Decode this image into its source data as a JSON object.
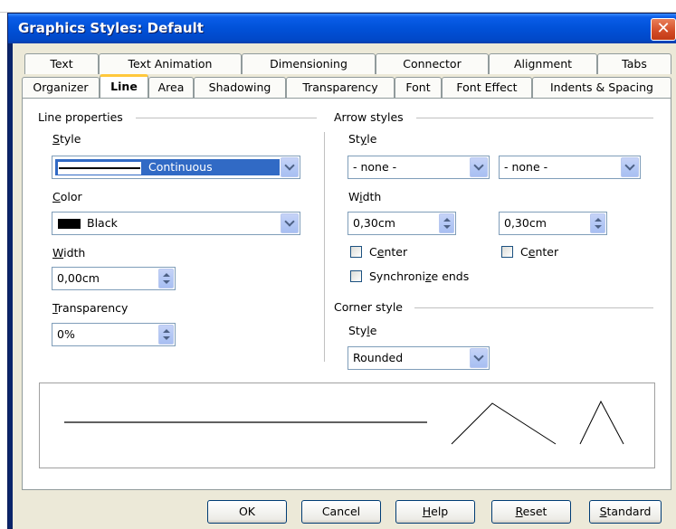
{
  "window": {
    "title": "Graphics Styles: Default",
    "close_symbol": "✕"
  },
  "tabs_row1": [
    "Text",
    "Text Animation",
    "Dimensioning",
    "Connector",
    "Alignment",
    "Tabs"
  ],
  "tabs_row2": [
    "Organizer",
    "Line",
    "Area",
    "Shadowing",
    "Transparency",
    "Font",
    "Font Effect",
    "Indents & Spacing"
  ],
  "active_tab": "Line",
  "line_properties": {
    "section_title": "Line properties",
    "style_label": "Style",
    "style_value": "Continuous",
    "color_label": "Color",
    "color_value": "Black",
    "color_swatch": "#000000",
    "width_label": "Width",
    "width_value": "0,00cm",
    "transparency_label": "Transparency",
    "transparency_value": "0%"
  },
  "arrow_styles": {
    "section_title": "Arrow styles",
    "style_label": "Style",
    "start_style_value": "- none -",
    "end_style_value": "- none -",
    "width_label": "Width",
    "start_width_value": "0,30cm",
    "end_width_value": "0,30cm",
    "center_start_label": "Center",
    "center_end_label": "Center",
    "sync_ends_label": "Synchronize ends"
  },
  "corner_style": {
    "section_title": "Corner style",
    "style_label": "Style",
    "style_value": "Rounded"
  },
  "buttons": {
    "ok": "OK",
    "cancel": "Cancel",
    "help": "Help",
    "reset": "Reset",
    "standard": "Standard"
  },
  "colors": {
    "titlebar": "#0151d8",
    "dialog_bg": "#ece9d8",
    "selection": "#316ac5",
    "active_tab_accent": "#ffc83c"
  }
}
